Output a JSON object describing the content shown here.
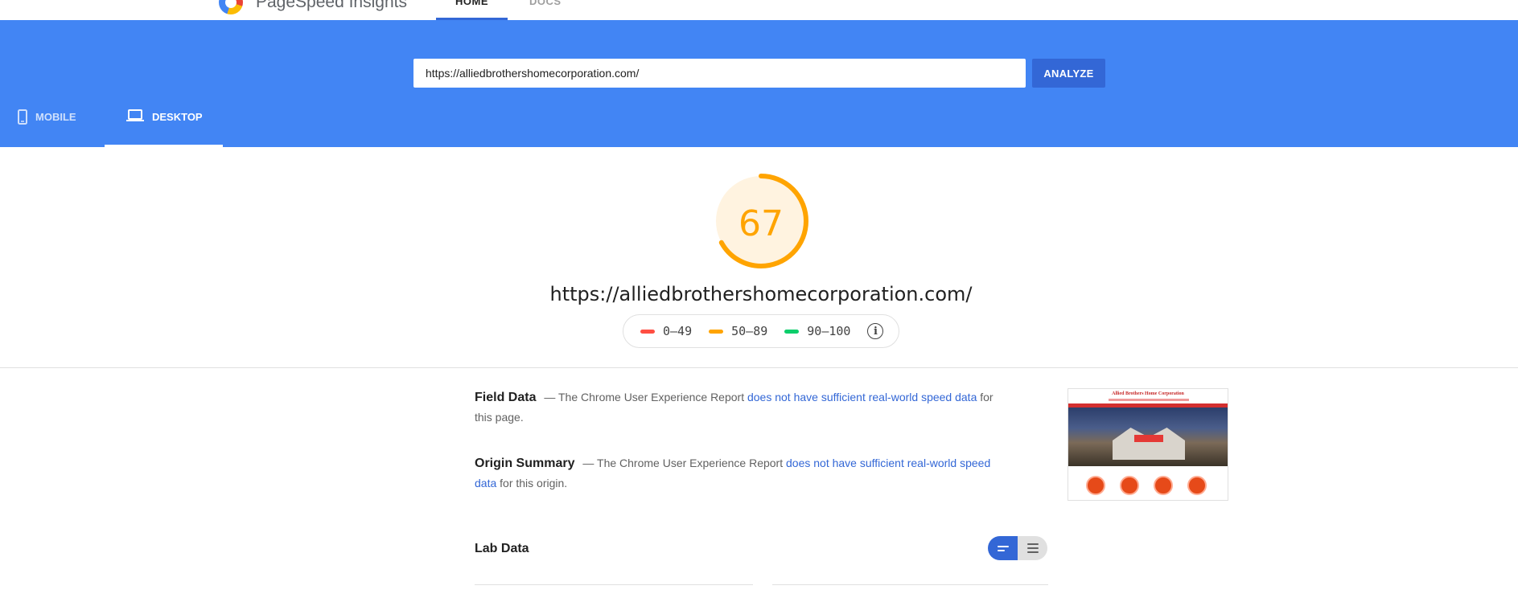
{
  "app": {
    "brand": "PageSpeed Insights",
    "nav": [
      {
        "label": "HOME",
        "active": true
      },
      {
        "label": "DOCS",
        "active": false
      }
    ]
  },
  "search": {
    "url_value": "https://alliedbrothershomecorporation.com/",
    "analyze_label": "ANALYZE"
  },
  "device_tabs": [
    {
      "label": "MOBILE",
      "icon": "phone-icon",
      "active": false
    },
    {
      "label": "DESKTOP",
      "icon": "laptop-icon",
      "active": true
    }
  ],
  "score": {
    "value": "67",
    "fraction": 0.67,
    "color": "#ffa400",
    "url": "https://alliedbrothershomecorporation.com/"
  },
  "legend": [
    {
      "label": "0–49",
      "color": "#ff4e42"
    },
    {
      "label": "50–89",
      "color": "#ffa400"
    },
    {
      "label": "90–100",
      "color": "#0cce6b"
    }
  ],
  "field_data": {
    "heading": "Field Data",
    "prefix": "— The Chrome User Experience Report ",
    "link": "does not have sufficient real-world speed data",
    "suffix": " for this page."
  },
  "origin_summary": {
    "heading": "Origin Summary",
    "prefix": "— The Chrome User Experience Report ",
    "link": "does not have sufficient real-world speed data",
    "suffix": " for this origin."
  },
  "lab_data": {
    "heading": "Lab Data"
  },
  "thumbnail": {
    "site_title": "Allied Brothers Home Corporation"
  },
  "colors": {
    "header_blue": "#4285f4",
    "accent_blue": "#3367d6",
    "average_orange": "#ffa400"
  }
}
